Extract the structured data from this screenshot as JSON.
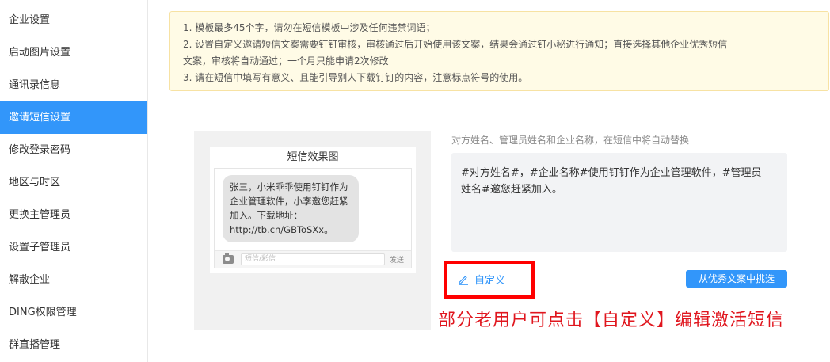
{
  "sidebar": {
    "items": [
      {
        "label": "企业设置"
      },
      {
        "label": "启动图片设置"
      },
      {
        "label": "通讯录信息"
      },
      {
        "label": "邀请短信设置"
      },
      {
        "label": "修改登录密码"
      },
      {
        "label": "地区与时区"
      },
      {
        "label": "更换主管理员"
      },
      {
        "label": "设置子管理员"
      },
      {
        "label": "解散企业"
      },
      {
        "label": "DING权限管理"
      },
      {
        "label": "群直播管理"
      }
    ],
    "active_item": "邀请短信设置"
  },
  "notice": {
    "lines": [
      "1. 模板最多45个字，请勿在短信模板中涉及任何违禁词语；",
      "2. 设置自定义邀请短信文案需要钉钉审核，审核通过后开始使用该文案，结果会通过钉小秘进行通知；直接选择其他企业优秀短信",
      "文案，审核将自动通过；一个月只能申请2次修改",
      "3. 请在短信中填写有意义、且能引导别人下载钉钉的内容，注意标点符号的使用。"
    ]
  },
  "preview": {
    "title": "短信效果图",
    "message_lines": [
      "张三，小米乖乖使用钉钉作为",
      "企业管理软件，小李邀您赶紧",
      "加入。下载地址：",
      "http://tb.cn/GBToSXx。"
    ],
    "input_placeholder": "短信/彩信",
    "send_label": "发送",
    "camera_icon": "camera-icon"
  },
  "editor": {
    "hint": "对方姓名、管理员姓名和企业名称，在短信中将自动替换",
    "content_lines": [
      "#对方姓名#，#企业名称#使用钉钉作为企业管理软件，#管理员",
      "姓名#邀您赶紧加入。"
    ]
  },
  "actions": {
    "custom_label": "自定义",
    "custom_icon": "pencil-icon",
    "pick_label": "从优秀文案中挑选"
  },
  "annotation": {
    "text": "部分老用户可点击【自定义】编辑激活短信",
    "color": "#e0161e"
  },
  "colors": {
    "accent": "#3296fa",
    "notice_bg": "#fffbe6",
    "highlight": "#ff0000"
  }
}
